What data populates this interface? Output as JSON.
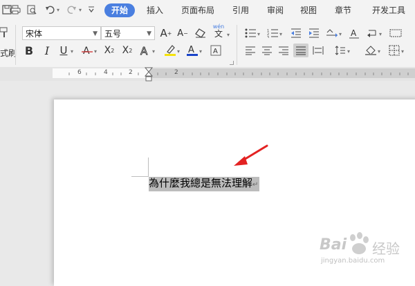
{
  "menu": {
    "tabs": [
      {
        "label": "开始",
        "active": true
      },
      {
        "label": "插入"
      },
      {
        "label": "页面布局"
      },
      {
        "label": "引用"
      },
      {
        "label": "审阅"
      },
      {
        "label": "视图"
      },
      {
        "label": "章节"
      },
      {
        "label": "开发工具"
      }
    ]
  },
  "toolbar": {
    "font_name": "宋体",
    "font_size": "五号",
    "format_painter_partial": "式刷",
    "pinyin_label_top": "wén",
    "pinyin_label_bottom": "文"
  },
  "ruler": {
    "numbers": [
      "6",
      "4",
      "2",
      "2"
    ]
  },
  "document": {
    "text": "為什麼我總是無法理解",
    "paragraph_mark": "↵"
  },
  "watermark": {
    "brand": "Bai",
    "brand_cn": "经验",
    "url": "jingyan.baidu.com"
  },
  "colors": {
    "accent": "#4a7fe0",
    "arrow": "#e32222",
    "font_color_bar": "#1a44c9",
    "highlight_bar": "#f5e20a",
    "strike_color": "#d23b3b"
  }
}
